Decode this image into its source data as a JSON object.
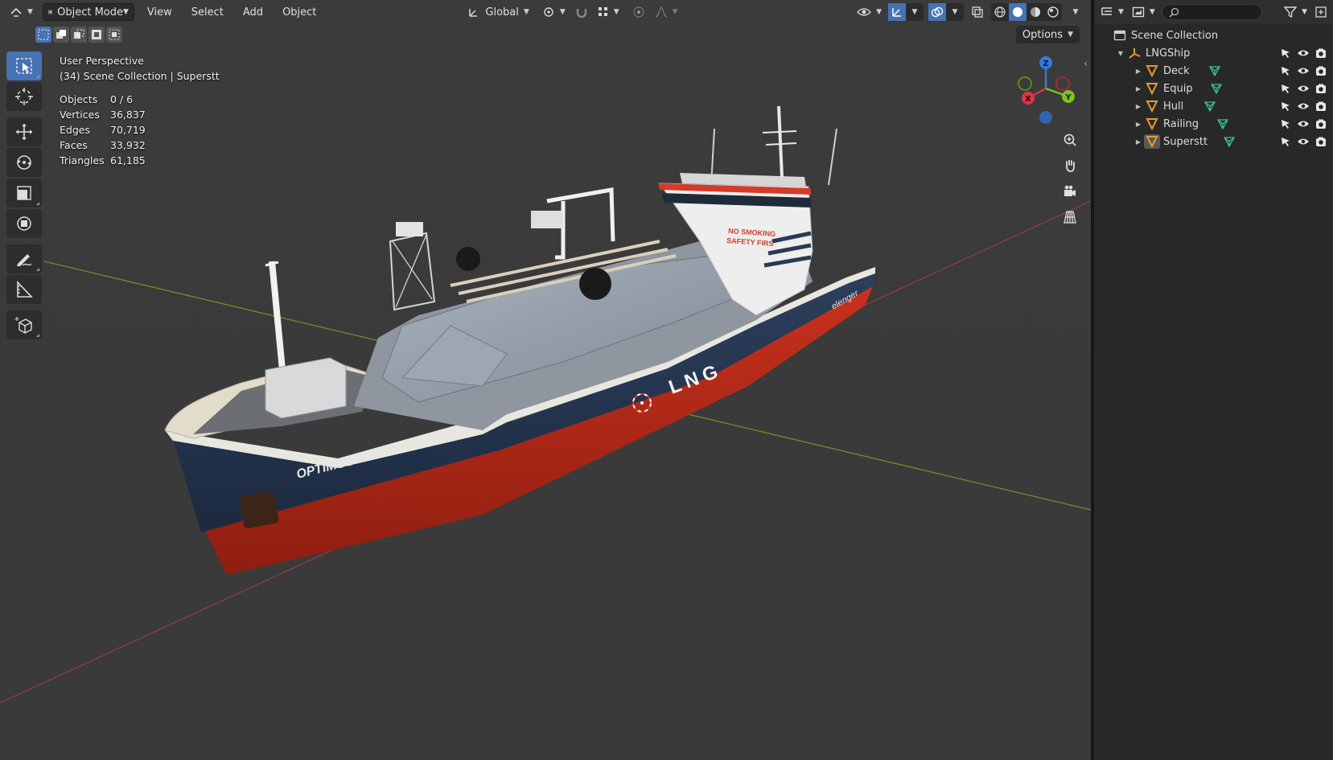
{
  "header": {
    "mode_label": "Object Mode",
    "menus": [
      "View",
      "Select",
      "Add",
      "Object"
    ],
    "orientation_label": "Global",
    "options_label": "Options"
  },
  "overlay": {
    "view_name": "User Perspective",
    "collection_path": "(34) Scene Collection | Superstt",
    "stats": [
      {
        "label": "Objects",
        "value": "0 / 6"
      },
      {
        "label": "Vertices",
        "value": "36,837"
      },
      {
        "label": "Edges",
        "value": "70,719"
      },
      {
        "label": "Faces",
        "value": "33,932"
      },
      {
        "label": "Triangles",
        "value": "61,185"
      }
    ]
  },
  "gizmo": {
    "x": "X",
    "y": "Y",
    "z": "Z"
  },
  "model": {
    "hull_name": "OPTIMUS",
    "cargo_label": "LNG",
    "warning_line1": "NO SMOKING",
    "warning_line2": "SAFETY FIRS",
    "brand": "elenger"
  },
  "outliner": {
    "scene_collection": "Scene Collection",
    "root": "LNGShip",
    "items": [
      {
        "label": "Deck",
        "active": false
      },
      {
        "label": "Equip",
        "active": false
      },
      {
        "label": "Hull",
        "active": false
      },
      {
        "label": "Railing",
        "active": false
      },
      {
        "label": "Superstt",
        "active": true
      }
    ]
  },
  "colors": {
    "accent": "#4772b3",
    "x_axis": "#ff3352",
    "y_axis": "#8bdc00",
    "z_axis": "#2890ff",
    "object_orange": "#e59a3a",
    "mesh_green": "#3fbf8f"
  },
  "tools": [
    "select-box",
    "cursor",
    "move",
    "rotate",
    "scale",
    "transform",
    "annotate",
    "measure",
    "add-cube"
  ]
}
